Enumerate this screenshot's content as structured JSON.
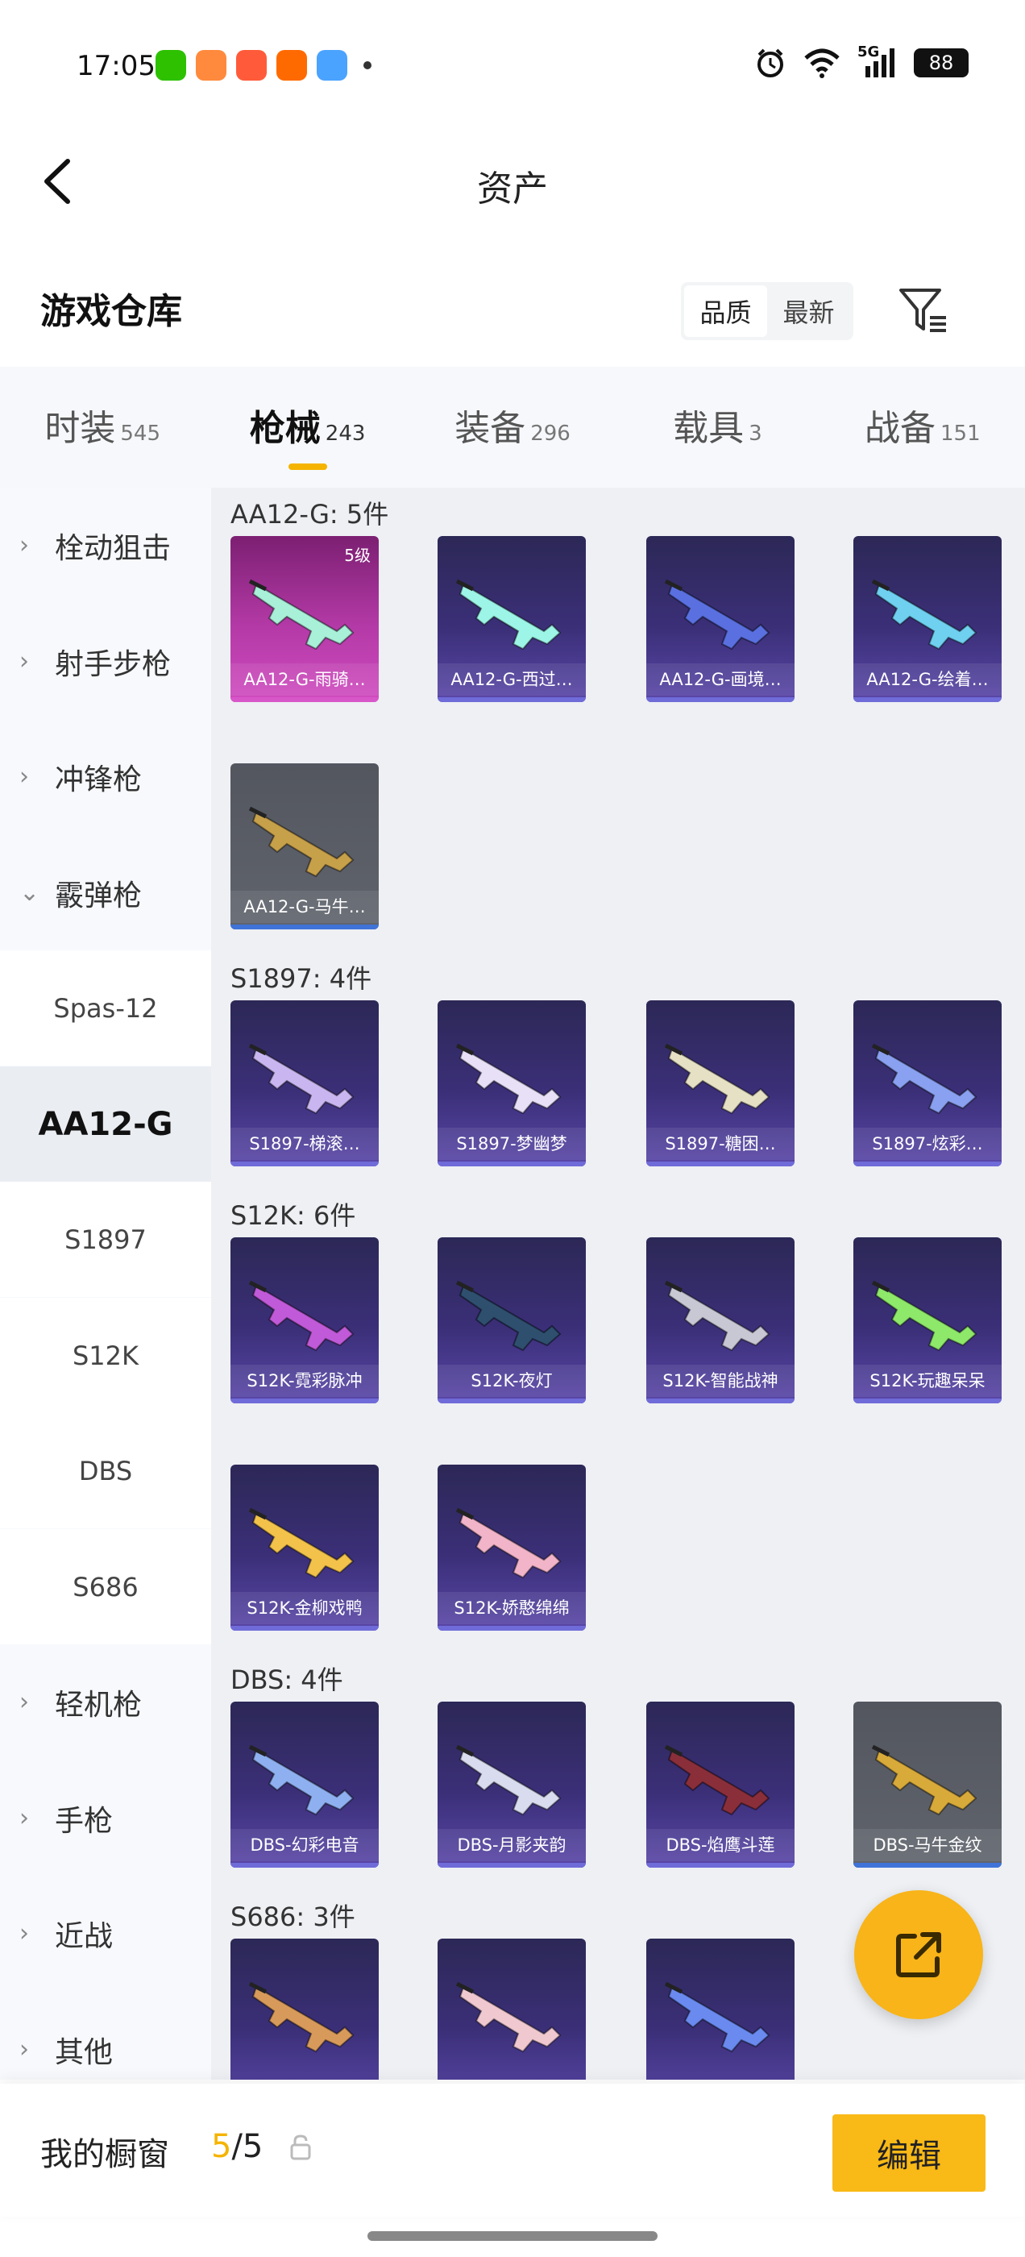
{
  "status_bar": {
    "time": "17:05",
    "app_icons": [
      {
        "name": "wechat-icon",
        "color": "#2dc100"
      },
      {
        "name": "mail-icon",
        "color": "#ff8a3d"
      },
      {
        "name": "game-icon",
        "color": "#ff5b3a"
      },
      {
        "name": "taobao-icon",
        "color": "#ff6a00"
      },
      {
        "name": "weather-icon",
        "color": "#4aa3ff"
      }
    ],
    "network": "5G",
    "battery": "88"
  },
  "nav": {
    "title": "资产"
  },
  "warehouse": {
    "title": "游戏仓库",
    "sort_options": [
      "品质",
      "最新"
    ],
    "sort_active": "品质"
  },
  "tabs": [
    {
      "label": "时装",
      "count": "545"
    },
    {
      "label": "枪械",
      "count": "243",
      "active": true
    },
    {
      "label": "装备",
      "count": "296"
    },
    {
      "label": "载具",
      "count": "3"
    },
    {
      "label": "战备",
      "count": "151"
    }
  ],
  "sidebar": {
    "categories": [
      {
        "label": "栓动狙击",
        "expanded": false
      },
      {
        "label": "射手步枪",
        "expanded": false
      },
      {
        "label": "冲锋枪",
        "expanded": false
      },
      {
        "label": "霰弹枪",
        "expanded": true
      }
    ],
    "subcategories": [
      "Spas-12",
      "AA12-G",
      "S1897",
      "S12K",
      "DBS",
      "S686"
    ],
    "selected": "AA12-G",
    "more_categories": [
      "轻机枪",
      "手枪",
      "近战",
      "其他"
    ]
  },
  "groups": [
    {
      "title": "AA12-G: 5件",
      "items": [
        {
          "label": "AA12-G-雨骑…",
          "badge": "5级",
          "style": "pink",
          "color": "#a8f0d8"
        },
        {
          "label": "AA12-G-西过…",
          "style": "purple",
          "color": "#9cf5e6"
        },
        {
          "label": "AA12-G-画境…",
          "style": "purple",
          "color": "#5a70e0"
        },
        {
          "label": "AA12-G-绘着…",
          "style": "purple",
          "color": "#6fd0f0"
        },
        {
          "label": "AA12-G-马牛…",
          "style": "grey",
          "color": "#c7a04a"
        }
      ]
    },
    {
      "title": "S1897: 4件",
      "items": [
        {
          "label": "S1897-梯滚…",
          "style": "purple",
          "color": "#c9b6f0"
        },
        {
          "label": "S1897-梦幽梦",
          "style": "purple",
          "color": "#e8e0f6"
        },
        {
          "label": "S1897-糖困…",
          "style": "purple",
          "color": "#e6e1c4"
        },
        {
          "label": "S1897-炫彩…",
          "style": "purple",
          "color": "#8aa0f0"
        }
      ]
    },
    {
      "title": "S12K: 6件",
      "items": [
        {
          "label": "S12K-霓彩脉冲",
          "style": "purple",
          "color": "#c05ad8"
        },
        {
          "label": "S12K-夜灯",
          "style": "purple",
          "color": "#2f4f6f"
        },
        {
          "label": "S12K-智能战神",
          "style": "purple",
          "color": "#c8c8d4"
        },
        {
          "label": "S12K-玩趣呆呆",
          "style": "purple",
          "color": "#8ee86a"
        },
        {
          "label": "S12K-金柳戏鸭",
          "style": "purple",
          "color": "#f2c24a"
        },
        {
          "label": "S12K-娇憨绵绵",
          "style": "purple",
          "color": "#f2b4c8"
        }
      ]
    },
    {
      "title": "DBS: 4件",
      "items": [
        {
          "label": "DBS-幻彩电音",
          "style": "purple",
          "color": "#8fb0f0"
        },
        {
          "label": "DBS-月影夹韵",
          "style": "purple",
          "color": "#d8dcee"
        },
        {
          "label": "DBS-焰鹰斗莲",
          "style": "purple",
          "color": "#8a2f3a"
        },
        {
          "label": "DBS-马牛金纹",
          "style": "grey",
          "color": "#d8aa3a"
        }
      ]
    },
    {
      "title": "S686: 3件",
      "items": [
        {
          "label": "",
          "style": "purple",
          "color": "#d89a5a"
        },
        {
          "label": "",
          "style": "purple",
          "color": "#f0c8d0"
        },
        {
          "label": "",
          "style": "purple",
          "color": "#6a8af0"
        }
      ]
    }
  ],
  "bottom": {
    "showcase_label": "我的橱窗",
    "showcase_current": "5",
    "showcase_total": "/5",
    "edit_label": "编辑"
  }
}
